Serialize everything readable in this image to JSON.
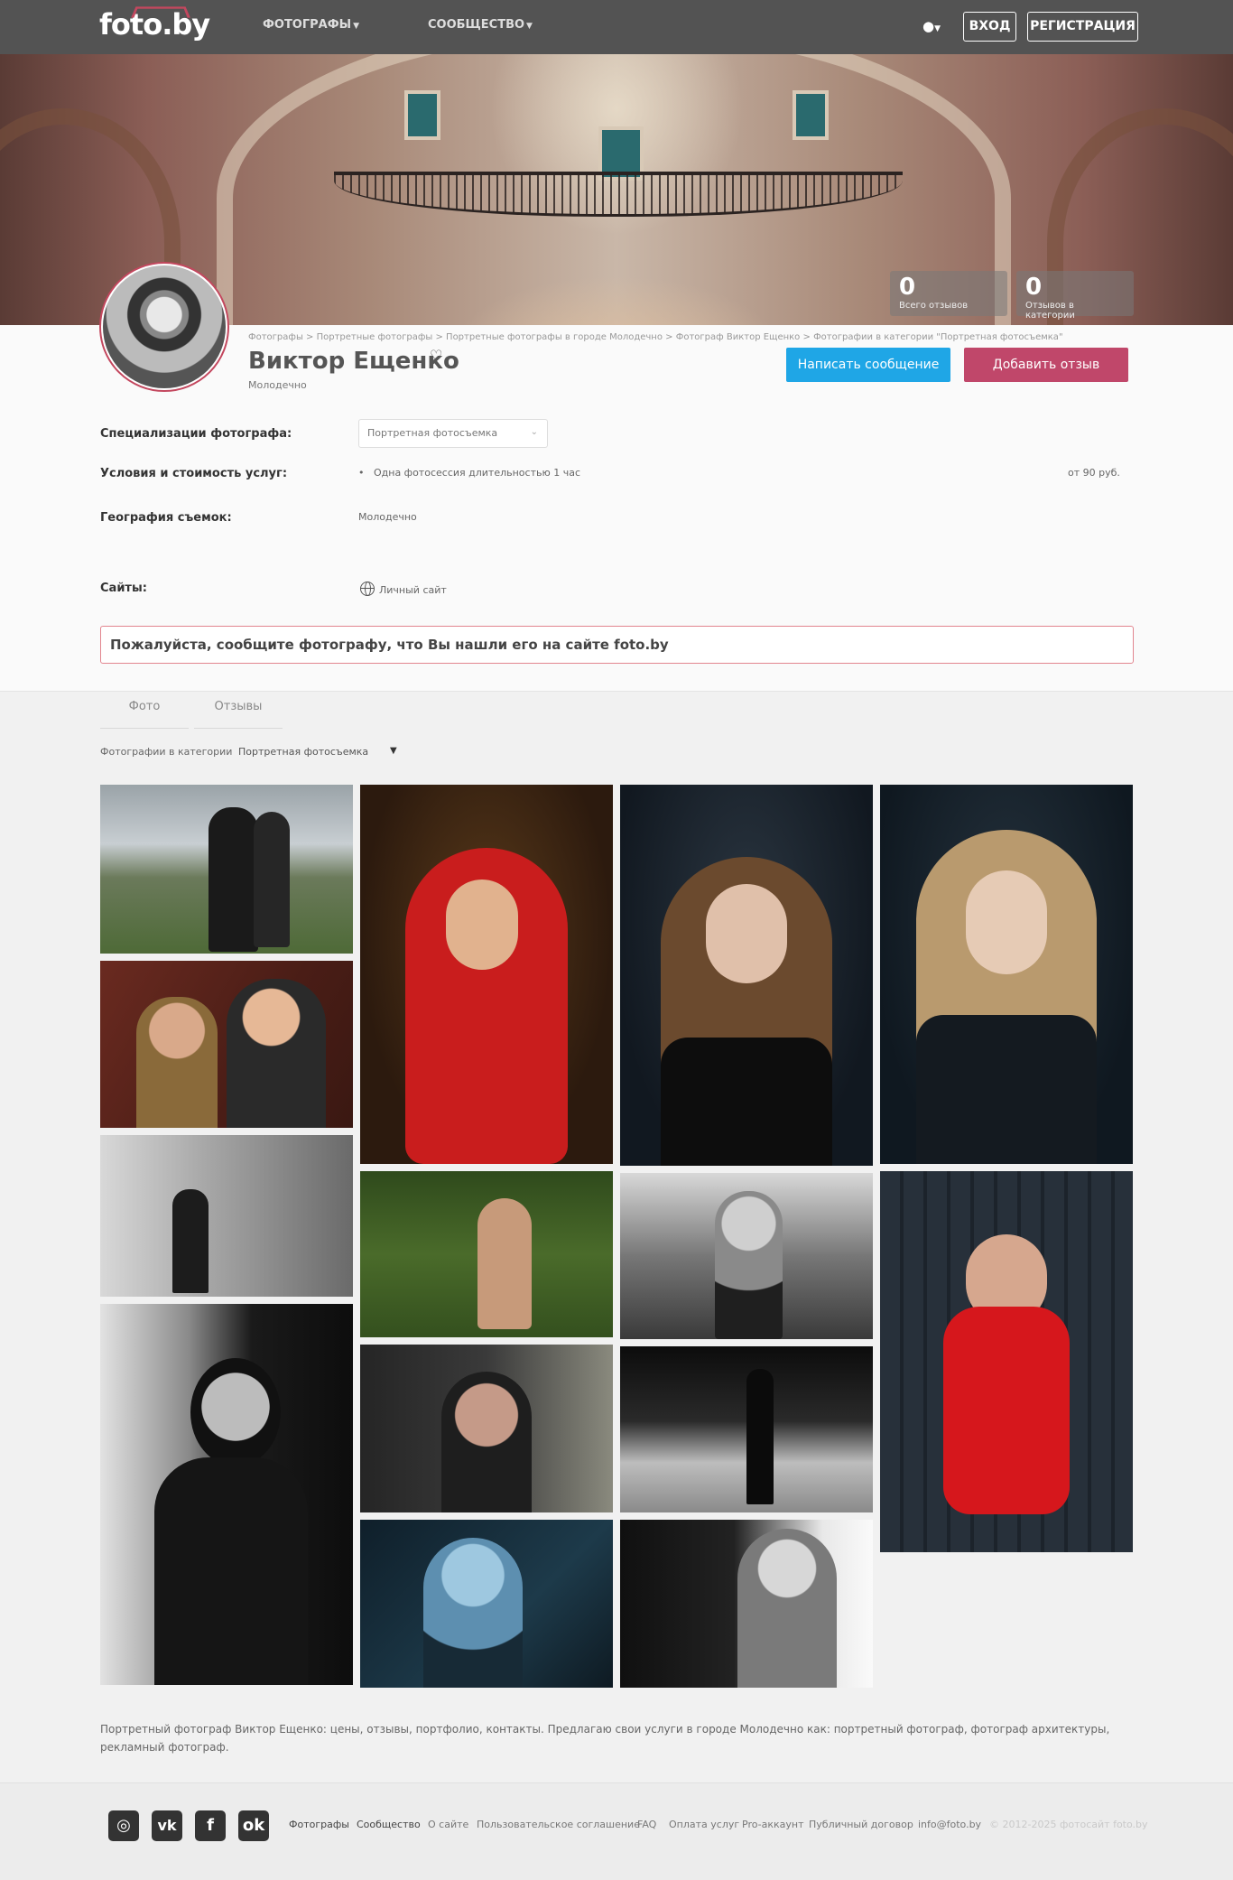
{
  "header": {
    "logo": "foto.by",
    "menu": [
      {
        "label": "ФОТОГРАФЫ"
      },
      {
        "label": "СООБЩЕСТВО"
      }
    ],
    "login": "ВХОД",
    "register": "РЕГИСТРАЦИЯ"
  },
  "stats": [
    {
      "value": "0",
      "label": "Всего отзывов"
    },
    {
      "value": "0",
      "label": "Отзывов в категории"
    }
  ],
  "breadcrumb": [
    "Фотографы",
    "Портретные фотографы",
    "Портретные фотографы в городе Молодечно",
    "Фотограф Виктор Ещенко",
    "Фотографии в категории \"Портретная фотосъемка\""
  ],
  "profile": {
    "name": "Виктор Ещенко",
    "city": "Молодечно",
    "write_message": "Написать сообщение",
    "add_review": "Добавить отзыв"
  },
  "info": {
    "spec_label": "Специализации фотографа:",
    "spec_value": "Портретная фотосъемка",
    "terms_label": "Условия и стоимость услуг:",
    "service": "Одна фотосессия длительностью 1 час",
    "price": "от 90 руб.",
    "geo_label": "География съемок:",
    "geo_value": "Молодечно",
    "sites_label": "Сайты:",
    "site_link": "Личный сайт"
  },
  "notice": "Пожалуйста, сообщите фотографу, что Вы нашли его на сайте foto.by",
  "tabs": [
    {
      "label": "Фото",
      "active": true
    },
    {
      "label": "Отзывы",
      "active": false
    }
  ],
  "filter": {
    "label": "Фотографии в категории",
    "value": "Портретная фотосъемка"
  },
  "description": "Портретный фотограф Виктор Ещенко: цены, отзывы, портфолио, контакты. Предлагаю свои услуги в городе Молодечно как: портретный фотограф, фотограф архитектуры, рекламный фотограф.",
  "footer": {
    "social": [
      {
        "icon": "instagram-icon"
      },
      {
        "icon": "vk-icon"
      },
      {
        "icon": "facebook-icon"
      },
      {
        "icon": "odnoklassniki-icon"
      }
    ],
    "links": [
      "Фотографы",
      "Сообщество",
      "О сайте",
      "Пользовательское соглашение",
      "FAQ",
      "Оплата услуг",
      "Pro-аккаунт",
      "Публичный договор",
      "info@foto.by"
    ],
    "copyright": "© 2012-2025 фотосайт foto.by"
  },
  "colors": {
    "accent": "#c3475e",
    "message_button": "#1fa6e6",
    "review_button": "#c0476a",
    "topbar": "#535353"
  }
}
